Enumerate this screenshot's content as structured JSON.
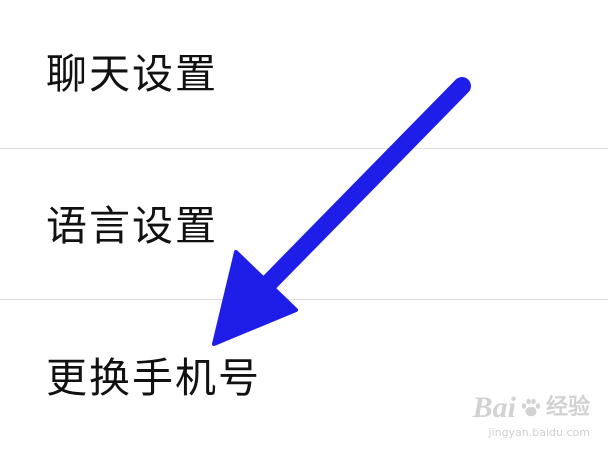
{
  "settings": {
    "items": [
      {
        "label": "聊天设置"
      },
      {
        "label": "语言设置"
      },
      {
        "label": "更换手机号"
      }
    ]
  },
  "annotation": {
    "arrow_color": "#1f1de8",
    "arrow_target": "更换手机号"
  },
  "watermark": {
    "brand": "Bai",
    "brand_cn": "经验",
    "url": "jingyan.baidu.com"
  }
}
